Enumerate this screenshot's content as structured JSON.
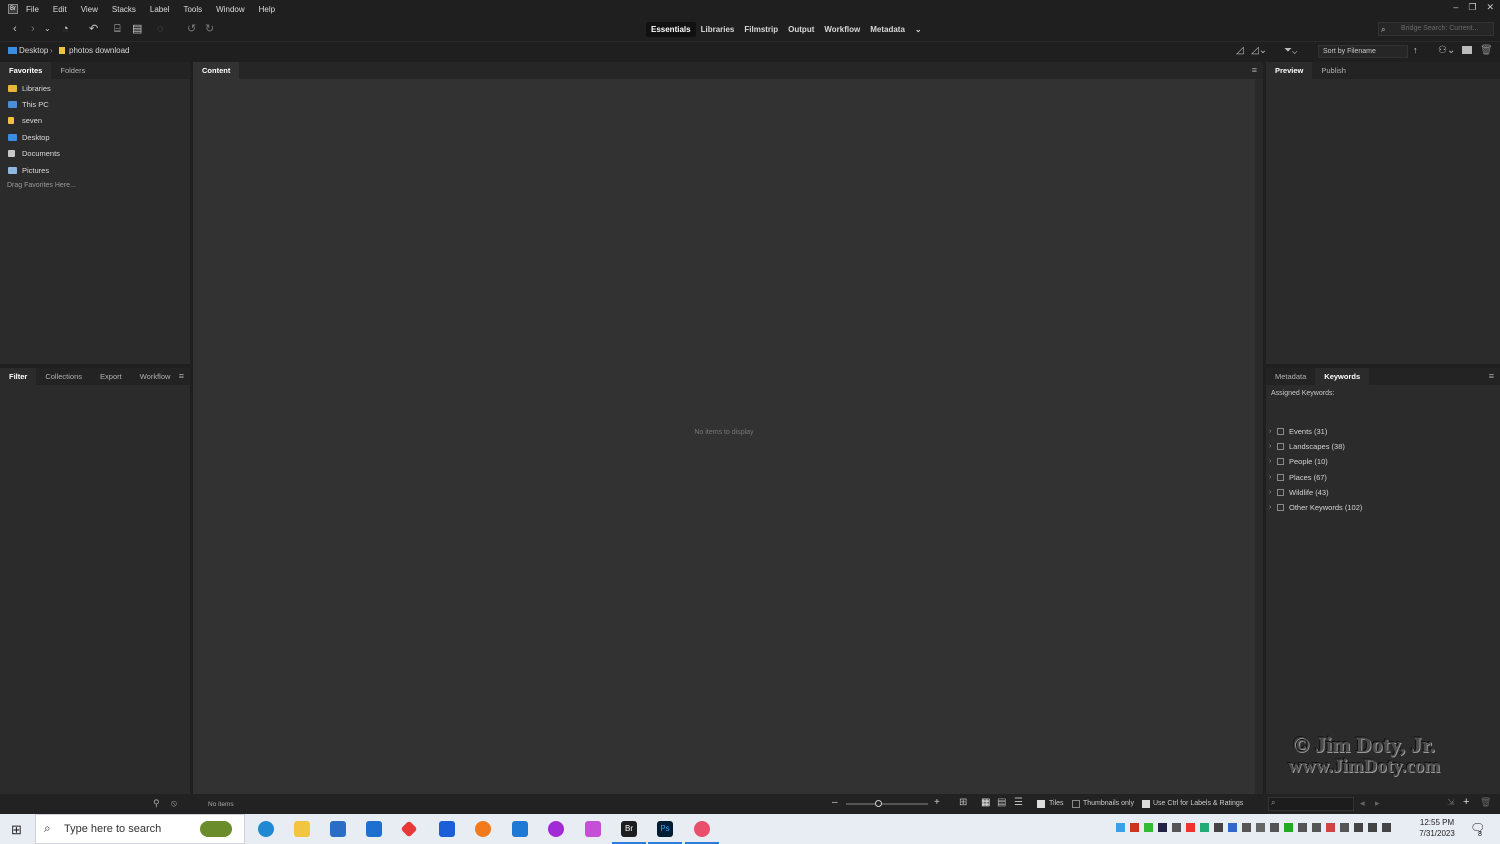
{
  "menu": {
    "items": [
      "File",
      "Edit",
      "View",
      "Stacks",
      "Label",
      "Tools",
      "Window",
      "Help"
    ]
  },
  "workspaces": [
    "Essentials",
    "Libraries",
    "Filmstrip",
    "Output",
    "Workflow",
    "Metadata"
  ],
  "active_workspace": "Essentials",
  "search": {
    "placeholder": "Bridge Search: Current..."
  },
  "path": {
    "root": "Desktop",
    "folder": "photos download"
  },
  "sort": {
    "label": "Sort by Filename"
  },
  "left_top": {
    "tabs": [
      "Favorites",
      "Folders"
    ],
    "favorites": [
      {
        "label": "Libraries",
        "color": "#e8b63a"
      },
      {
        "label": "This PC",
        "color": "#4a8fd6"
      },
      {
        "label": "seven",
        "color": "#f0c040"
      },
      {
        "label": "Desktop",
        "color": "#3a8de0"
      },
      {
        "label": "Documents",
        "color": "#c8c8c8"
      },
      {
        "label": "Pictures",
        "color": "#8fb8e0"
      }
    ],
    "drag_hint": "Drag Favorites Here..."
  },
  "left_bottom": {
    "tabs": [
      "Filter",
      "Collections",
      "Export",
      "Workflow"
    ]
  },
  "content": {
    "tab": "Content",
    "empty": "No items to display"
  },
  "right_top": {
    "tabs": [
      "Preview",
      "Publish"
    ]
  },
  "right_bottom": {
    "tabs": [
      "Metadata",
      "Keywords"
    ],
    "assigned": "Assigned Keywords:",
    "keywords": [
      "Events (31)",
      "Landscapes (38)",
      "People (10)",
      "Places (67)",
      "Wildlife (43)",
      "Other Keywords (102)"
    ]
  },
  "status": {
    "items": "No items",
    "tiles": "Tiles",
    "thumbs": "Thumbnails only",
    "ctrl": "Use Ctrl for Labels & Ratings"
  },
  "taskbar": {
    "search": "Type here to search",
    "time": "12:55 PM",
    "date": "7/31/2023",
    "notif": "8"
  },
  "watermark": {
    "line1": "© Jim Doty, Jr.",
    "line2": "www.JimDoty.com"
  }
}
